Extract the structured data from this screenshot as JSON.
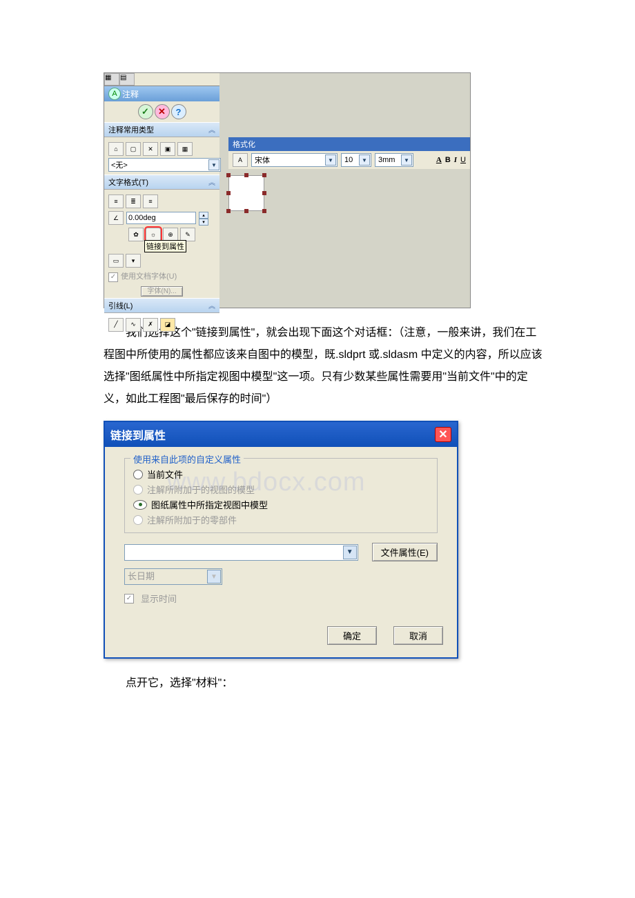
{
  "panel": {
    "title": "注释",
    "section_common": "注释常用类型",
    "none_option": "<无>",
    "section_text_format": "文字格式(T)",
    "angle_value": "0.00deg",
    "tooltip_link": "链接到属性",
    "use_doc_font": "使用文档字体(U)",
    "font_btn": "字体(N)...",
    "section_leader": "引线(L)"
  },
  "format_bar": {
    "title": "格式化",
    "font_name": "宋体",
    "size": "10",
    "unit": "3mm",
    "styles": {
      "a": "A",
      "b": "B",
      "i": "I",
      "u": "U"
    }
  },
  "para1": "我们选择这个\"链接到属性\"，就会出现下面这个对话框：（注意，一般来讲，我们在工程图中所使用的属性都应该来自图中的模型，既.sldprt 或.sldasm 中定义的内容，所以应该选择\"图纸属性中所指定视图中模型\"这一项。只有少数某些属性需要用\"当前文件\"中的定义，如此工程图\"最后保存的时间\"）",
  "dialog": {
    "title": "链接到属性",
    "group_title": "使用来自此项的自定义属性",
    "opt1": "当前文件",
    "opt2": "注解所附加于的视图的模型",
    "opt3": "图纸属性中所指定视图中模型",
    "opt4": "注解所附加于的零部件",
    "file_props_btn": "文件属性(E)",
    "date_format": "长日期",
    "show_time": "显示时间",
    "ok": "确定",
    "cancel": "取消"
  },
  "watermark": "www.bdocx.com",
  "para2": "点开它，选择\"材料\"："
}
